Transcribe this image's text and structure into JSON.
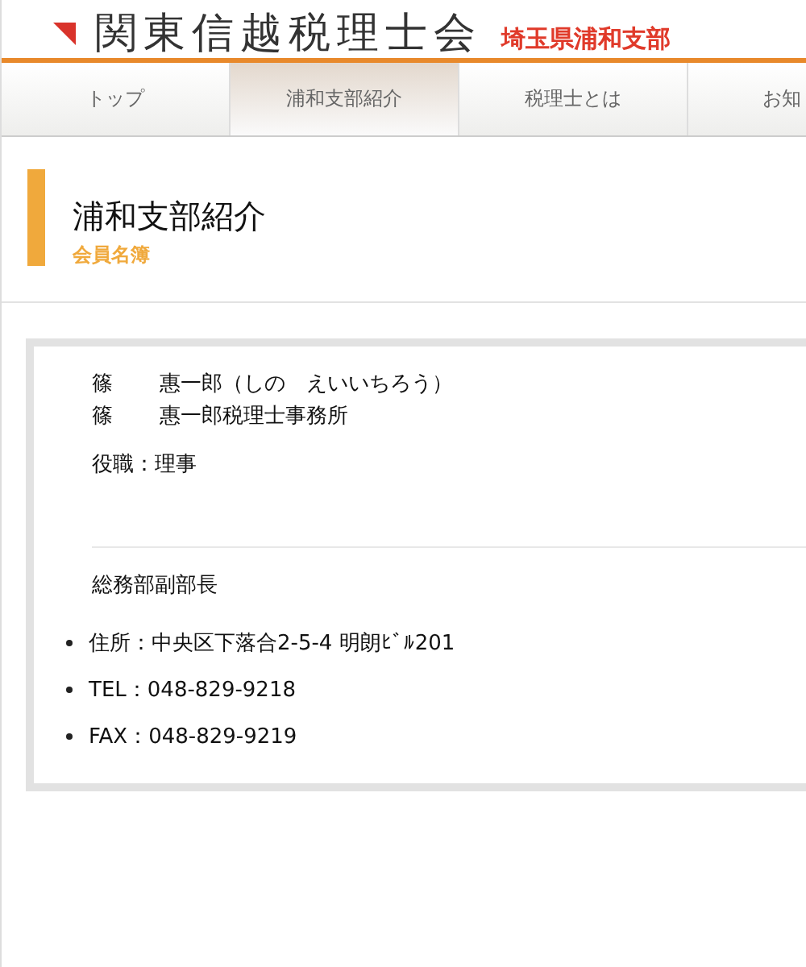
{
  "header": {
    "logo_text": "関東信越税理士会",
    "branch": "埼玉県浦和支部"
  },
  "nav": [
    {
      "label": "トップ",
      "selected": false
    },
    {
      "label": "浦和支部紹介",
      "selected": true
    },
    {
      "label": "税理士とは",
      "selected": false
    },
    {
      "label": "お知",
      "selected": false
    }
  ],
  "page_title": {
    "title": "浦和支部紹介",
    "subtitle": "会員名簿"
  },
  "member": {
    "name_lines": [
      {
        "surname": "篠",
        "rest": "惠一郎（しの　えいいちろう）"
      },
      {
        "surname": "篠",
        "rest": "惠一郎税理士事務所"
      }
    ],
    "position": "役職：理事",
    "role": "総務部副部長",
    "contacts": [
      "住所：中央区下落合2-5-4 明朗ﾋﾞﾙ201",
      "TEL：048-829-9218",
      "FAX：048-829-9219"
    ]
  }
}
